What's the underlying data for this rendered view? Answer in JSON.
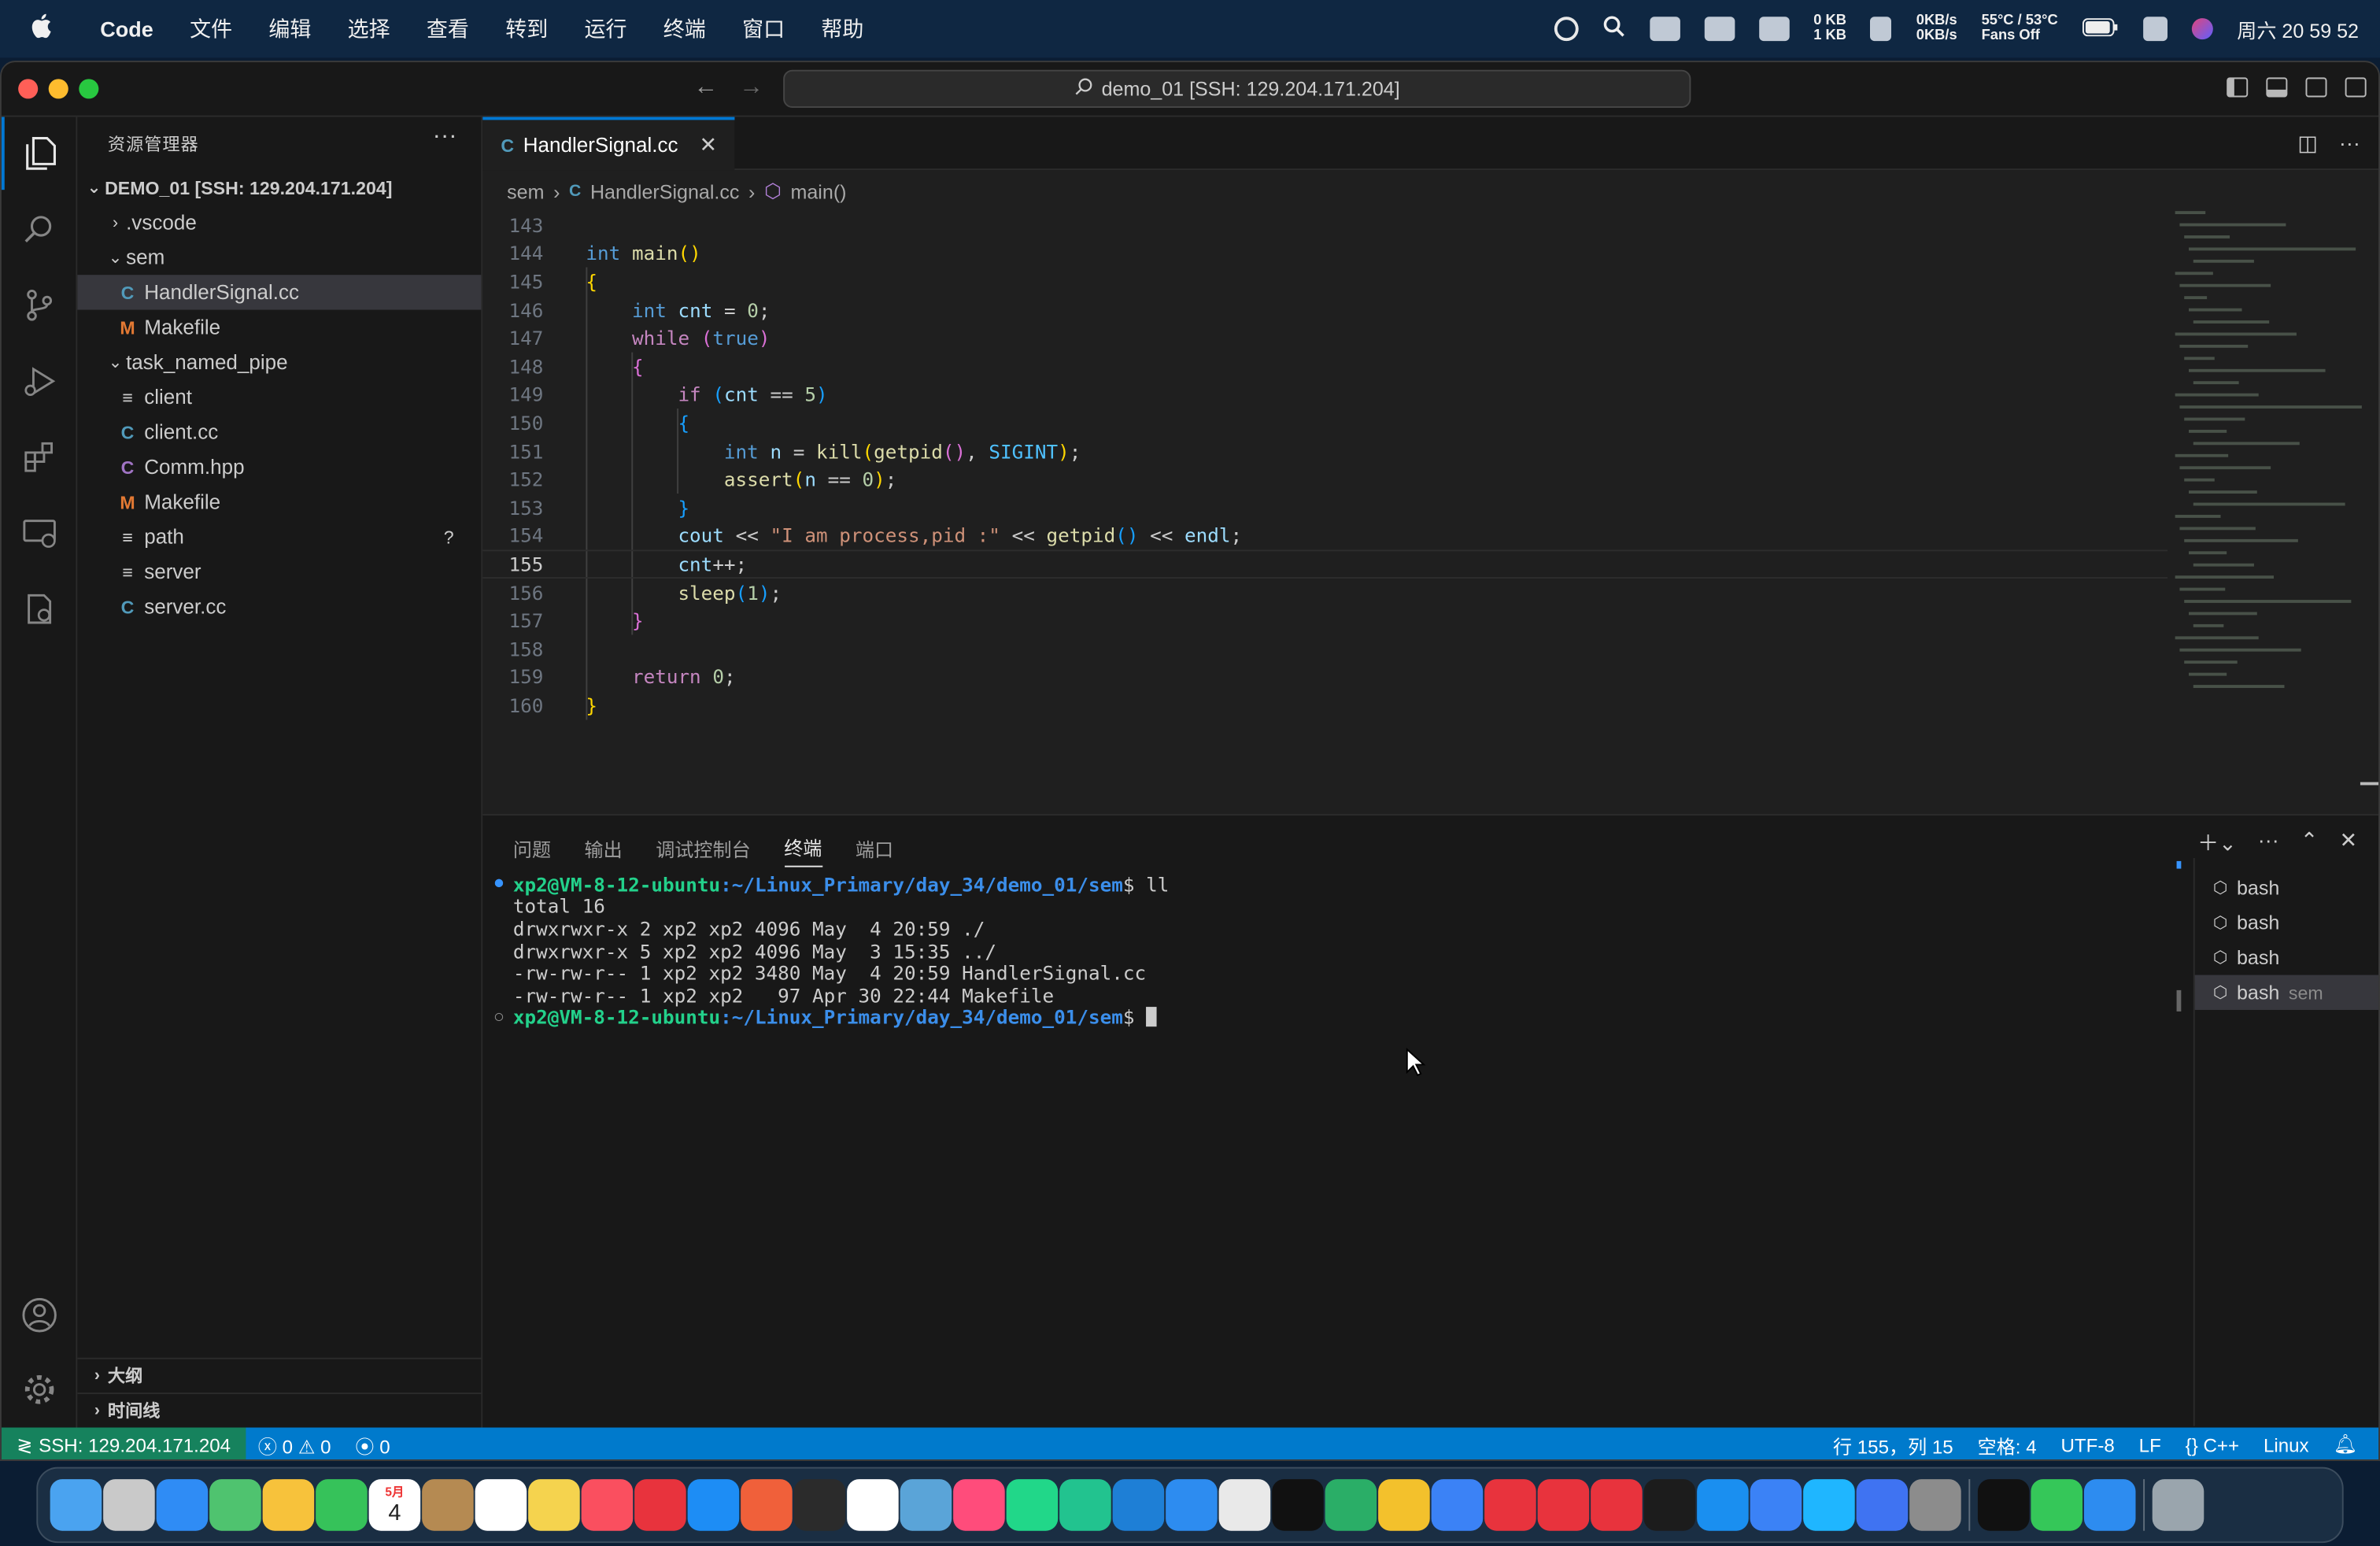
{
  "menubar": {
    "apple": "",
    "app": "Code",
    "items": [
      "文件",
      "编辑",
      "选择",
      "查看",
      "转到",
      "运行",
      "终端",
      "窗口",
      "帮助"
    ],
    "net_up": "0 KB",
    "net_down": "1 KB",
    "disk_r": "0KB/s",
    "disk_w": "0KB/s",
    "temp": "55°C / 53°C",
    "fans": "Fans Off",
    "clock": "周六 20 59 52"
  },
  "window": {
    "command_center": "demo_01 [SSH: 129.204.171.204]"
  },
  "sidebar": {
    "title": "资源管理器",
    "root": "DEMO_01 [SSH: 129.204.171.204]",
    "items": [
      {
        "label": ".vscode",
        "icon": "chevron-right-icon"
      },
      {
        "label": "sem",
        "icon": "chevron-down-icon"
      },
      {
        "label": "HandlerSignal.cc",
        "icon": "cpp-file-icon"
      },
      {
        "label": "Makefile",
        "icon": "makefile-icon"
      },
      {
        "label": "task_named_pipe",
        "icon": "chevron-down-icon"
      },
      {
        "label": "client",
        "icon": "text-file-icon"
      },
      {
        "label": "client.cc",
        "icon": "cpp-file-icon"
      },
      {
        "label": "Comm.hpp",
        "icon": "cpp-file-icon"
      },
      {
        "label": "Makefile",
        "icon": "makefile-icon"
      },
      {
        "label": "path",
        "icon": "text-file-icon"
      },
      {
        "label": "server",
        "icon": "text-file-icon"
      },
      {
        "label": "server.cc",
        "icon": "cpp-file-icon"
      }
    ],
    "path_badge": "?",
    "outline": "大纲",
    "timeline": "时间线"
  },
  "editor": {
    "tab": "HandlerSignal.cc",
    "breadcrumb": [
      "sem",
      "HandlerSignal.cc",
      "main()"
    ],
    "line_numbers": [
      "143",
      "144",
      "145",
      "146",
      "147",
      "148",
      "149",
      "150",
      "151",
      "152",
      "153",
      "154",
      "155",
      "156",
      "157",
      "158",
      "159",
      "160"
    ],
    "current_line": "155"
  },
  "panel": {
    "tabs": [
      "问题",
      "输出",
      "调试控制台",
      "终端",
      "端口"
    ],
    "active_tab": "终端",
    "prompt_user": "xp2@VM-8-12-ubuntu",
    "prompt_path": ":~/Linux_Primary/day_34/demo_01/sem",
    "prompt_sign": "$ ",
    "command": "ll",
    "output": [
      "total 16",
      "drwxrwxr-x 2 xp2 xp2 4096 May  4 20:59 ./",
      "drwxrwxr-x 5 xp2 xp2 4096 May  3 15:35 ../",
      "-rw-rw-r-- 1 xp2 xp2 3480 May  4 20:59 HandlerSignal.cc",
      "-rw-rw-r-- 1 xp2 xp2   97 Apr 30 22:44 Makefile"
    ],
    "terminals": [
      {
        "label": "bash",
        "sub": ""
      },
      {
        "label": "bash",
        "sub": ""
      },
      {
        "label": "bash",
        "sub": ""
      },
      {
        "label": "bash",
        "sub": "sem"
      }
    ]
  },
  "statusbar": {
    "remote": "SSH: 129.204.171.204",
    "errors": "0",
    "warnings": "0",
    "ports": "0",
    "position": "行 155，列 15",
    "spaces": "空格: 4",
    "encoding": "UTF-8",
    "eol": "LF",
    "language": "C++",
    "os": "Linux"
  },
  "dock": {
    "apps": [
      "Finder",
      "Launchpad",
      "Mail",
      "Maps",
      "Photos",
      "Messages",
      "Calendar",
      "Contacts",
      "Reminders",
      "Notes",
      "Music",
      "Youdao",
      "App Store",
      "Git",
      "Terminal",
      "Typora",
      "Preview",
      "IntelliJ",
      "PyCharm",
      "CLion",
      "VS Code",
      "Safari",
      "Chrome",
      "QQ",
      "WeChat",
      "Flashcards",
      "K",
      "NetEase Music",
      "WPS",
      "PDF",
      "Terminal2",
      "Prompt",
      "Speed",
      "Play",
      "Feishu",
      "System Settings",
      "TikTok",
      "FaceTime",
      "Wiz",
      "Trash"
    ],
    "calendar_day": "4",
    "calendar_month": "5月"
  },
  "colors": {
    "accent": "#0078d4",
    "statusbar": "#007acc",
    "remote": "#16825d"
  }
}
